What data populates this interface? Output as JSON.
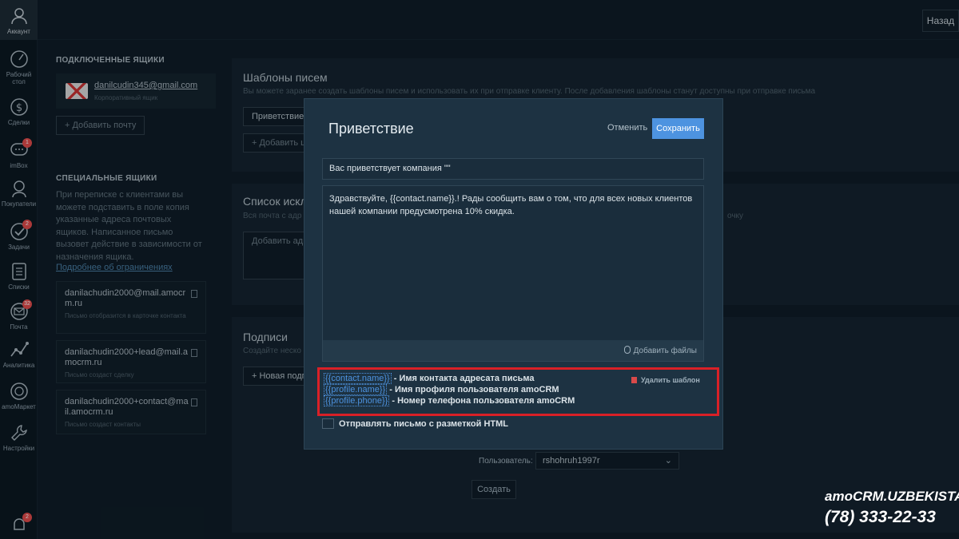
{
  "nav": {
    "account": "Аккаунт",
    "items": [
      {
        "label": "Рабочий стол",
        "icon": "speedometer-icon",
        "badge": ""
      },
      {
        "label": "Сделки",
        "icon": "dollar-icon",
        "badge": ""
      },
      {
        "label": "imBox",
        "icon": "chat-icon",
        "badge": "1"
      },
      {
        "label": "Покупатели",
        "icon": "customers-icon",
        "badge": ""
      },
      {
        "label": "Задачи",
        "icon": "check-icon",
        "badge": "2"
      },
      {
        "label": "Списки",
        "icon": "list-icon",
        "badge": ""
      },
      {
        "label": "Почта",
        "icon": "mail-icon",
        "badge": "32"
      },
      {
        "label": "Аналитика",
        "icon": "analytics-icon",
        "badge": ""
      },
      {
        "label": "amoМаркет",
        "icon": "market-icon",
        "badge": ""
      },
      {
        "label": "Настройки",
        "icon": "settings-icon",
        "badge": ""
      }
    ],
    "bottom_badge": "2"
  },
  "topbar": {
    "back": "Назад"
  },
  "left": {
    "connected_title": "ПОДКЛЮЧЕННЫЕ ЯЩИКИ",
    "mailbox_email": "danilcudin345@gmail.com",
    "mailbox_sub": "Корпоративный ящик",
    "add_mail": "+ Добавить почту",
    "special_title": "СПЕЦИАЛЬНЫЕ ЯЩИКИ",
    "special_text": "При переписке с клиентами вы можете подставить в поле копия указанные адреса почтовых ящиков. Написанное письмо вызовет действие в зависимости от назначения ящика.",
    "limits_link": "Подробнее об ограничениях",
    "special_boxes": [
      {
        "address": "danilachudin2000@mail.amocrm.ru",
        "note": "Письмо отобразится в карточке контакта"
      },
      {
        "address": "danilachudin2000+lead@mail.amocrm.ru",
        "note": "Письмо создаст сделку"
      },
      {
        "address": "danilachudin2000+contact@mail.amocrm.ru",
        "note": "Письмо создаст контакты"
      }
    ]
  },
  "panels": {
    "templates_title": "Шаблоны писем",
    "templates_sub": "Вы можете заранее создать шаблоны писем и использовать их при отправке клиенту. После добавления шаблоны станут доступны при отправке письма",
    "template_item": "Приветствие",
    "add_template": "+ Добавить ш",
    "exclusions_title": "Список исключ",
    "exclusions_sub": "Вся почта с адр",
    "exclusions_tail": "очку",
    "exclusions_placeholder": "Добавить адр",
    "signatures_title": "Подписи",
    "signatures_sub": "Создайте неско",
    "new_signature": "+ Новая подп"
  },
  "modal": {
    "title": "Приветствие",
    "cancel": "Отменить",
    "save": "Сохранить",
    "subject": "Вас приветствует компания \"\"",
    "body": "Здравствуйте, {{contact.name}}.! Рады сообщить вам о том, что для всех новых клиентов нашей компании предусмотрена 10% скидка.",
    "attach": "Добавить файлы",
    "variables": [
      {
        "token": "{{contact.name}}",
        "desc": " - Имя контакта адресата письма"
      },
      {
        "token": "{{profile.name}}",
        "desc": " - Имя профиля пользователя amoCRM"
      },
      {
        "token": "{{profile.phone}}",
        "desc": " - Номер телефона пользователя amoCRM"
      }
    ],
    "delete_template": "Удалить шаблон",
    "html_checkbox": "Отправлять письмо с разметкой HTML"
  },
  "signature_form": {
    "user_label": "Пользователь:",
    "user_value": "rshohruh1997r",
    "create": "Создать"
  },
  "watermark": {
    "brand": "amoCRM.UZBEKISTAN",
    "phone": "(78) 333-22-33"
  }
}
